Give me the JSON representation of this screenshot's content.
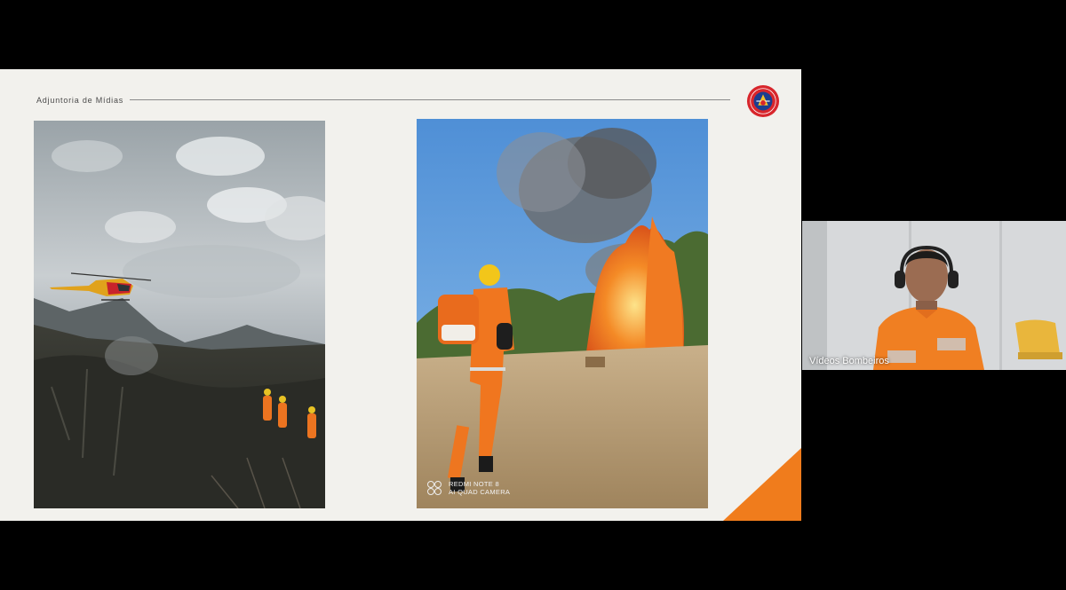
{
  "slide": {
    "header_text": "Adjuntoria de Mídias",
    "logo_icon": "fire-department-crest-icon",
    "accent_color": "#f07c1c"
  },
  "photo_right": {
    "watermark_line1": "REDMI NOTE 8",
    "watermark_line2": "AI QUAD CAMERA"
  },
  "video": {
    "participant_name": "Vídeos Bombeiros"
  }
}
